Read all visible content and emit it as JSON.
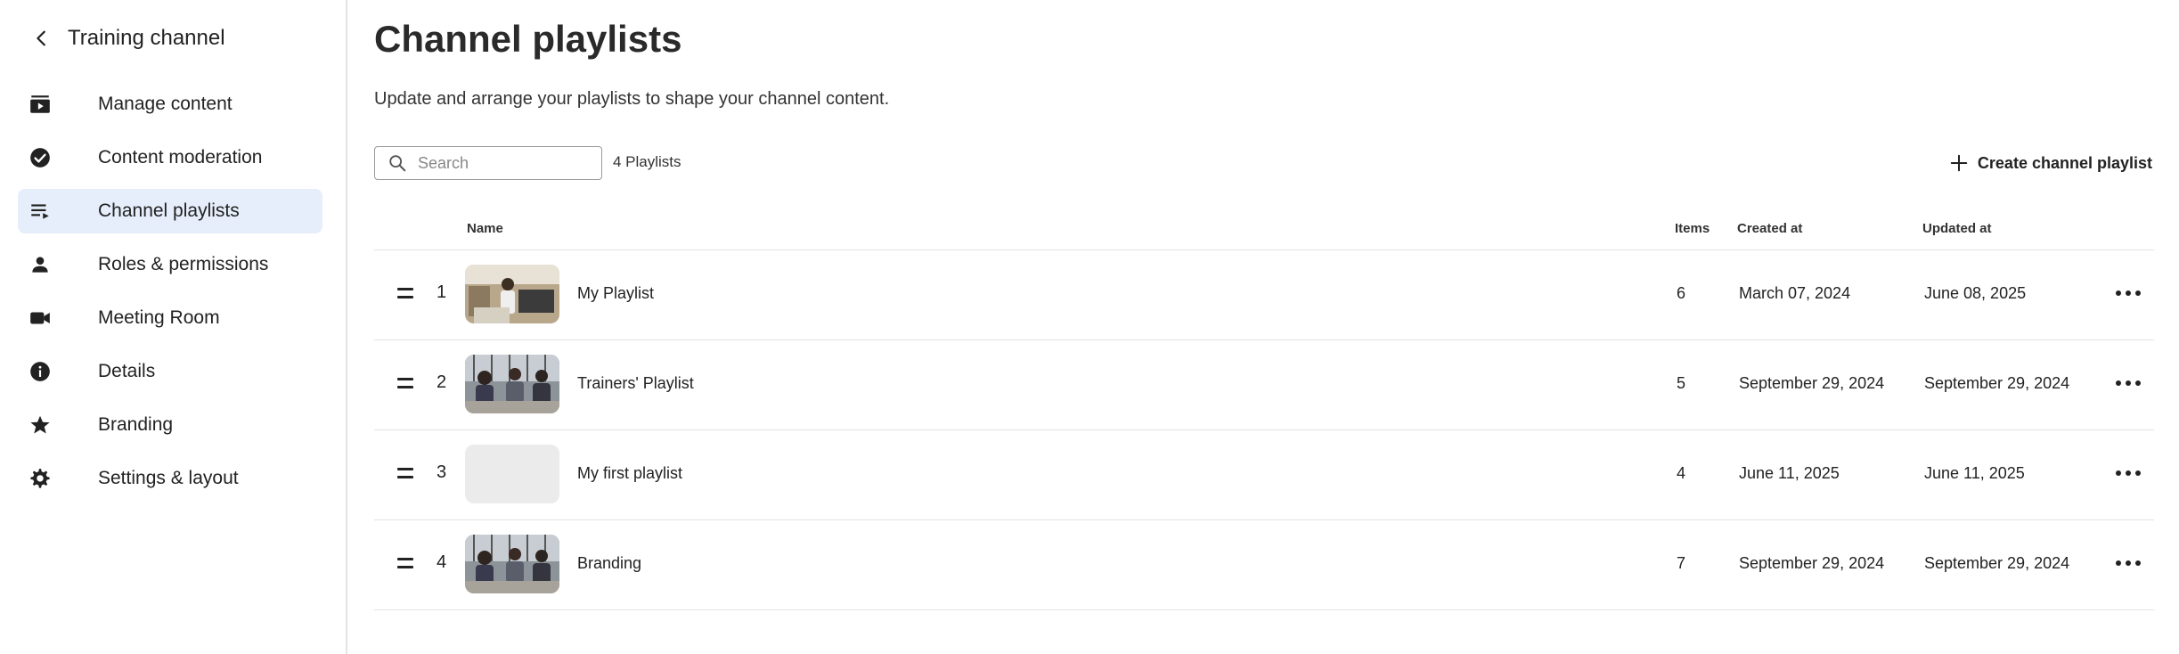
{
  "sidebar": {
    "back_title": "Training channel",
    "items": [
      {
        "label": "Manage content",
        "icon": "video-library-icon"
      },
      {
        "label": "Content moderation",
        "icon": "check-circle-icon"
      },
      {
        "label": "Channel playlists",
        "icon": "playlist-icon",
        "active": true
      },
      {
        "label": "Roles & permissions",
        "icon": "person-icon"
      },
      {
        "label": "Meeting Room",
        "icon": "videocam-icon"
      },
      {
        "label": "Details",
        "icon": "info-icon"
      },
      {
        "label": "Branding",
        "icon": "star-icon"
      },
      {
        "label": "Settings & layout",
        "icon": "gear-icon"
      }
    ]
  },
  "main": {
    "title": "Channel playlists",
    "subtitle": "Update and arrange your playlists to shape your channel content.",
    "search_placeholder": "Search",
    "count": "4 Playlists",
    "create_label": "Create channel playlist"
  },
  "table": {
    "headers": {
      "name": "Name",
      "items": "Items",
      "created": "Created at",
      "updated": "Updated at"
    },
    "rows": [
      {
        "position": "1",
        "name": "My Playlist",
        "items": "6",
        "created": "March 07, 2024",
        "updated": "June 08, 2025",
        "thumb": "lab"
      },
      {
        "position": "2",
        "name": "Trainers' Playlist",
        "items": "5",
        "created": "September 29, 2024",
        "updated": "September 29, 2024",
        "thumb": "meeting"
      },
      {
        "position": "3",
        "name": "My first playlist",
        "items": "4",
        "created": "June 11, 2025",
        "updated": "June 11, 2025",
        "thumb": "empty"
      },
      {
        "position": "4",
        "name": "Branding",
        "items": "7",
        "created": "September 29, 2024",
        "updated": "September 29, 2024",
        "thumb": "meeting"
      }
    ]
  },
  "colors": {
    "active_bg": "#e6eefb",
    "border": "#e2e2e2",
    "text": "#222222"
  }
}
